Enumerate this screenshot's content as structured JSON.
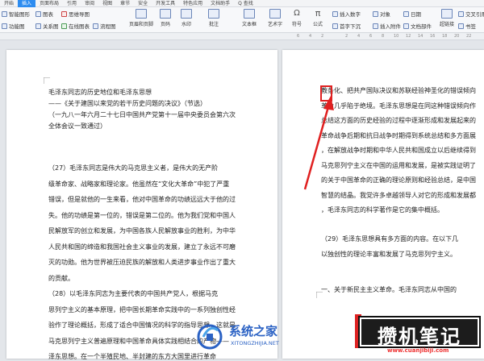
{
  "menubar": {
    "tabs": [
      "开始",
      "插入",
      "页面布局",
      "引用",
      "审阅",
      "视图",
      "章节",
      "安全",
      "开发工具",
      "特色应用",
      "文档助手",
      "Q 查找"
    ],
    "active_tab": "插入"
  },
  "ribbon": {
    "smart_graph": "智能图形",
    "chart": "图表",
    "mind_map": "思维导图",
    "function_graph": "功能图",
    "relation_graph": "关系图",
    "online_chart": "在线图表",
    "flowchart": "流程图",
    "header_footer": "页眉和页脚",
    "page_number": "页码",
    "watermark": "水印",
    "comment": "批注",
    "textbox": "文本框",
    "art_text": "艺术字",
    "symbol": "符号",
    "formula": "公式",
    "insert_number": "插入数字",
    "object": "对象",
    "first_letter_sink": "首字下沉",
    "insert_attachment": "插入附件",
    "date": "日期",
    "doc_parts": "文档部件",
    "cross_reference": "交叉引用",
    "hyperlink": "超链接",
    "bookmark": "书签",
    "pi_symbol": "π",
    "omega_symbol": "Ω"
  },
  "ruler": {
    "ticks": [
      "6",
      "4",
      "2",
      "",
      "2",
      "4",
      "6",
      "8",
      "10",
      "12",
      "14",
      "16",
      "18",
      "20",
      "22"
    ]
  },
  "page1": {
    "title": "毛泽东同志的历史地位和毛泽东思想",
    "subtitle": "——《关于建国以来党的若干历史问题的决议》（节选）",
    "date_line": "（一九八一年六月二十七日中国共产党第十一届中央委员会第六次",
    "date_line2": "全体会议一致通过）",
    "para27": [
      "（27）毛泽东同志是伟大的马克思主义者，是伟大的无产阶",
      "级革命家、战略家和理论家。他虽然在“文化大革命”中犯了严重",
      "错误，但是就他的一生来看，他对中国革命的功绩远远大于他的过",
      "失。他的功绩是第一位的，错误是第二位的。他为我们党和中国人",
      "民解放军的创立和发展，为中国各族人民解放事业的胜利，为中华",
      "人民共和国的缔造和我国社会主义事业的发展，建立了永远不可磨",
      "灭的功勋。他为世界被压迫民族的解放和人类进步事业作出了重大",
      "的贡献。"
    ],
    "para28": [
      "（28）以毛泽东同志为主要代表的中国共产党人，根据马克",
      "思列宁主义的基本原理，把中国长期革命实践中的一系列独创性经",
      "验作了理论概括，形成了适合中国情况的科学的指导思想，这就是",
      "马克思列宁主义普遍原理和中国革命具体实践相结合的产物——",
      "泽东思想。在一个半殖民地、半封建的东方大国里进行革命"
    ]
  },
  "page2": {
    "lines": [
      "教条化、把共产国际决议和苏联经验神圣化的错误倾向",
      "革命几乎陷于绝境。毛泽东思想是在同这种错误倾向作",
      "总结这方面的历史经验的过程中逐渐形成和发展起来的",
      "革命战争后期和抗日战争时期得到系统总结和多方面展",
      "，在解放战争时期和中华人民共和国成立以后继续得到",
      "马克思列宁主义在中国的运用和发展，是被实践证明了",
      "的关于中国革命的正确的理论原则和经验总结，是中国",
      "智慧的结晶。我党许多卓越领导人对它的形成和发展都",
      "，毛泽东同志的科学著作是它的集中概括。"
    ],
    "para29": [
      "（29）毛泽东思想具有多方面的内容。在以下几",
      "以独创性的理论丰富和发展了马克思列宁主义。"
    ],
    "section1": "一、关于新民主主义革命。毛泽东同志从中国的"
  },
  "watermarks": {
    "xitong_name": "系统之家",
    "xitong_url": "XITONGZHIJIA.NET",
    "cuanji_name": "攒机笔记",
    "cuanji_url": "www.cuanjibiji.com"
  },
  "colors": {
    "accent": "#2d8cf0",
    "highlight_red": "#e02020",
    "watermark_blue": "#2b62c4"
  }
}
